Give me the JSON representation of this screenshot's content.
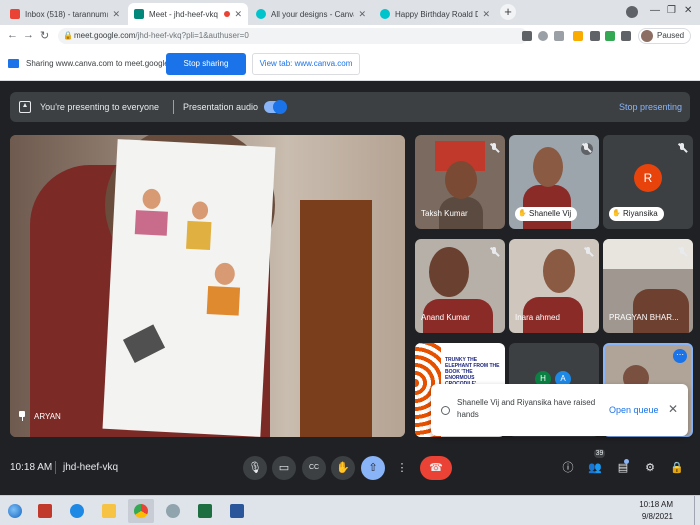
{
  "browser": {
    "tabs": [
      {
        "title": "Inbox (518) - tarannum@theindi",
        "icon": "gmail-icon",
        "active": false
      },
      {
        "title": "Meet - jhd-heef-vkq",
        "icon": "meet-icon",
        "active": true
      },
      {
        "title": "All your designs - Canva",
        "icon": "canva-icon",
        "active": false
      },
      {
        "title": "Happy Birthday Roald Dahl",
        "icon": "canva-icon",
        "active": false
      }
    ],
    "url_main": "meet.google.com",
    "url_rest": "/jhd-heef-vkq?pli=1&authuser=0",
    "profile_status": "Paused"
  },
  "sharebar": {
    "text": "Sharing www.canva.com to meet.google.com",
    "stop_label": "Stop sharing",
    "view_label": "View tab: www.canva.com"
  },
  "presenting": {
    "text": "You're presenting to everyone",
    "audio_label": "Presentation audio",
    "audio_on": true,
    "stop_label": "Stop presenting"
  },
  "main_tile": {
    "name": "ARYAN"
  },
  "participants": [
    {
      "name": "Taksh Kumar",
      "muted": true,
      "hand": false
    },
    {
      "name": "Shanelle Vij",
      "muted": true,
      "hand": true
    },
    {
      "name": "Riyansika",
      "muted": true,
      "hand": true,
      "avatar_letter": "R"
    },
    {
      "name": "Anand Kumar",
      "muted": true,
      "hand": false
    },
    {
      "name": "Inara ahmed",
      "muted": true,
      "hand": false
    },
    {
      "name": "PRAGYAN BHAR...",
      "muted": true,
      "hand": false
    }
  ],
  "extra_tiles": {
    "book_text": "TRUNKY THE ELEPHANT FROM THE BOOK 'THE ENORMOUS CROCODILE'",
    "avatar_letters": [
      "H",
      "A"
    ]
  },
  "notification": {
    "text": "Shanelle Vij and Riyansika have raised hands",
    "action": "Open queue"
  },
  "meetbar": {
    "time": "10:18 AM",
    "code": "jhd-heef-vkq",
    "participant_count": "39"
  },
  "taskbar": {
    "time": "10:18 AM",
    "date": "9/8/2021"
  },
  "colors": {
    "accent": "#1a73e8",
    "leave": "#ea4335",
    "present": "#8ab4f8",
    "avatar_r": "#e8430a"
  }
}
